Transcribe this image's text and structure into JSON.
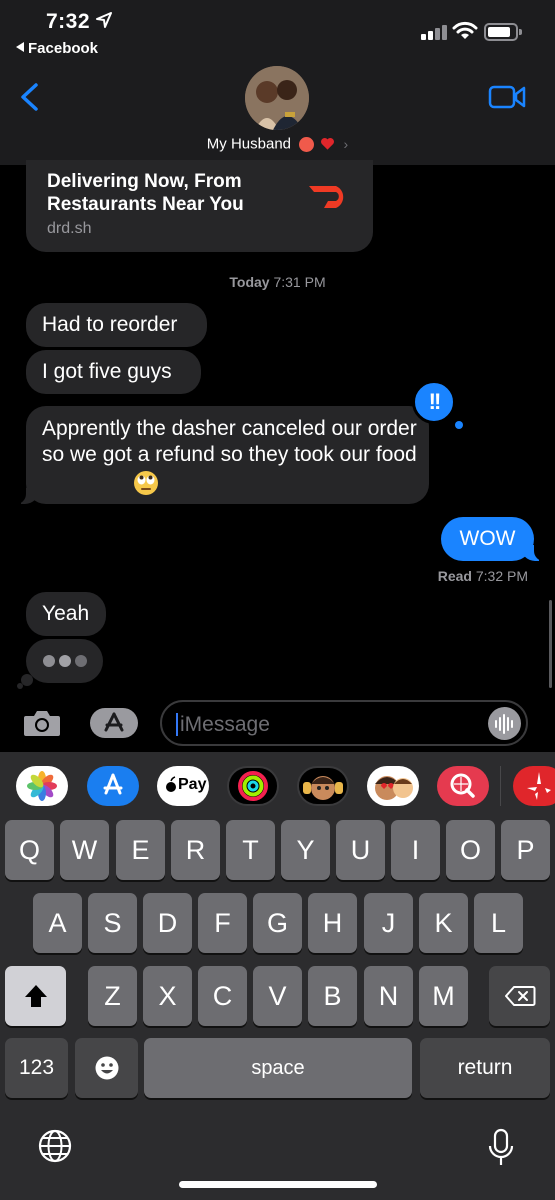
{
  "status_bar": {
    "time": "7:32",
    "back_app": "Facebook"
  },
  "header": {
    "contact_name": "My Husband"
  },
  "messages": {
    "link_preview": {
      "title": "Delivering Now, From Restaurants Near You",
      "domain": "drd.sh"
    },
    "timestamp_label": "Today",
    "timestamp_time": "7:31 PM",
    "incoming": [
      "Had to reorder",
      "I got five guys",
      "Apprently the dasher canceled our order so we got a refund so they took our food",
      "Yeah"
    ],
    "reaction": "!!",
    "outgoing": "WOW",
    "read_label": "Read",
    "read_time": "7:32 PM"
  },
  "input": {
    "placeholder": "iMessage"
  },
  "apps": [
    "photos",
    "app-store",
    "apple-pay",
    "fitness",
    "memoji-1",
    "memoji-2",
    "search-images",
    "yelp"
  ],
  "apple_pay_label": "Pay",
  "keyboard": {
    "row1": [
      "Q",
      "W",
      "E",
      "R",
      "T",
      "Y",
      "U",
      "I",
      "O",
      "P"
    ],
    "row2": [
      "A",
      "S",
      "D",
      "F",
      "G",
      "H",
      "J",
      "K",
      "L"
    ],
    "row3": [
      "Z",
      "X",
      "C",
      "V",
      "B",
      "N",
      "M"
    ],
    "numbers_key": "123",
    "space_key": "space",
    "return_key": "return"
  },
  "colors": {
    "imessage_blue": "#1a84ff",
    "incoming_bubble": "#262628",
    "keyboard_bg": "#2c2c2e",
    "key": "#6d6d71"
  }
}
